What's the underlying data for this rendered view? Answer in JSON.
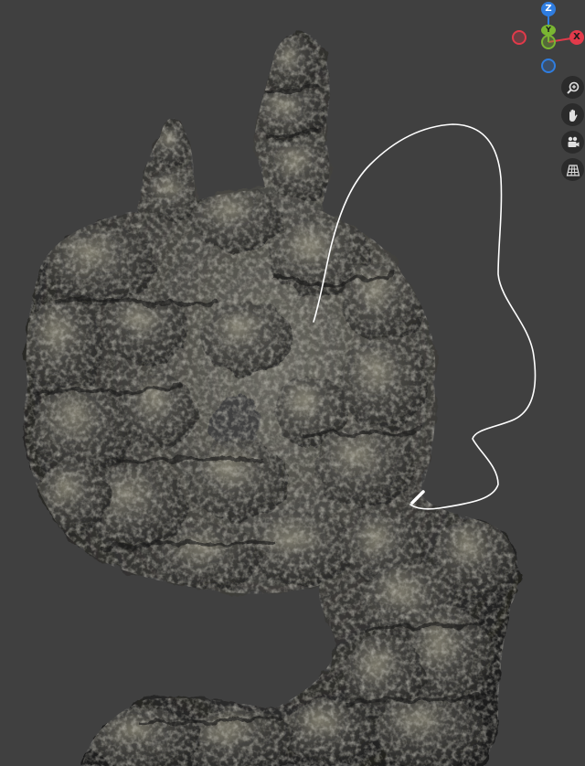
{
  "viewport": {
    "background": "#404040",
    "object": "rock-arch"
  },
  "gizmo": {
    "z_label": "Z",
    "y_label": "Y",
    "x_label": "X",
    "colors": {
      "x": "#e23a4a",
      "y": "#7ab632",
      "z": "#2f7de0"
    }
  },
  "nav_tools": [
    {
      "icon": "zoom-icon"
    },
    {
      "icon": "hand-pan-icon"
    },
    {
      "icon": "camera-icon"
    },
    {
      "icon": "perspective-grid-icon"
    }
  ]
}
